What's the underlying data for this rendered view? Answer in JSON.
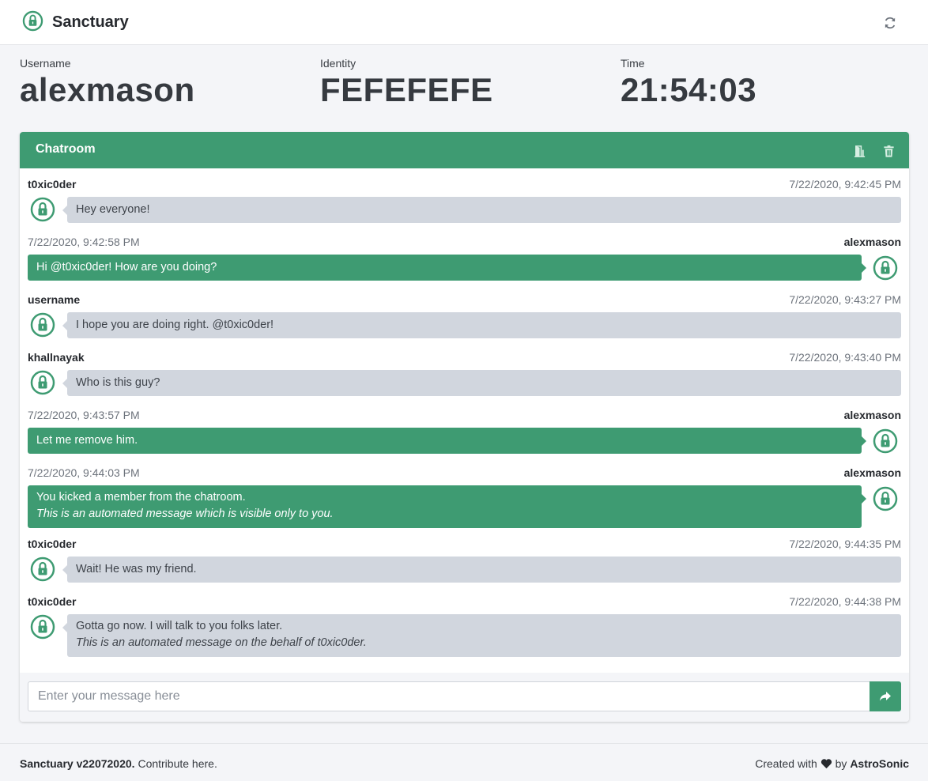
{
  "app": {
    "title": "Sanctuary"
  },
  "stats": {
    "username_label": "Username",
    "username": "alexmason",
    "identity_label": "Identity",
    "identity": "FEFEFEFE",
    "time_label": "Time",
    "time": "21:54:03"
  },
  "chat": {
    "title": "Chatroom",
    "messages": [
      {
        "sender": "t0xic0der",
        "timestamp": "7/22/2020, 9:42:45 PM",
        "text": "Hey everyone!"
      },
      {
        "sender": "alexmason",
        "timestamp": "7/22/2020, 9:42:58 PM",
        "text": "Hi @t0xic0der! How are you doing?"
      },
      {
        "sender": "username",
        "timestamp": "7/22/2020, 9:43:27 PM",
        "text": "I hope you are doing right. @t0xic0der!"
      },
      {
        "sender": "khallnayak",
        "timestamp": "7/22/2020, 9:43:40 PM",
        "text": "Who is this guy?"
      },
      {
        "sender": "alexmason",
        "timestamp": "7/22/2020, 9:43:57 PM",
        "text": "Let me remove him."
      },
      {
        "sender": "alexmason",
        "timestamp": "7/22/2020, 9:44:03 PM",
        "text": "You kicked a member from the chatroom.",
        "note": "This is an automated message which is visible only to you."
      },
      {
        "sender": "t0xic0der",
        "timestamp": "7/22/2020, 9:44:35 PM",
        "text": "Wait! He was my friend."
      },
      {
        "sender": "t0xic0der",
        "timestamp": "7/22/2020, 9:44:38 PM",
        "text": "Gotta go now. I will talk to you folks later.",
        "note": "This is an automated message on the behalf of t0xic0der."
      }
    ],
    "input_placeholder": "Enter your message here"
  },
  "footer": {
    "version": "Sanctuary v22072020.",
    "contribute": " Contribute here.",
    "created_with": "Created with",
    "by": " by ",
    "author": "AstroSonic"
  },
  "colors": {
    "accent": "#3e9b72",
    "bubble_in": "#d1d6de",
    "background": "#f4f5f8"
  },
  "icons": {
    "brand": "lock-circle-icon",
    "refresh": "refresh-icon",
    "leave": "door-icon",
    "delete": "trash-icon",
    "send": "share-arrow-icon",
    "heart": "heart-icon"
  }
}
